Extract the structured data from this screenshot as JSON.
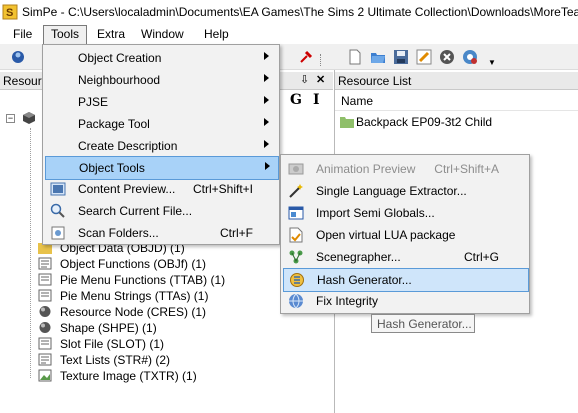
{
  "window": {
    "title": "SimPe - C:\\Users\\localadmin\\Documents\\EA Games\\The Sims 2 Ultimate Collection\\Downloads\\MoreTea_..."
  },
  "menubar": {
    "items": [
      "File",
      "Tools",
      "Extra",
      "Window",
      "Help"
    ]
  },
  "left_panel": {
    "header": "Resource",
    "header_buttons": [
      "⇩",
      "✕"
    ],
    "text_buttons": [
      "G",
      "I"
    ]
  },
  "right_panel": {
    "header": "Resource List",
    "column": "Name",
    "item": "Backpack EP09-3t2 Child"
  },
  "tree": {
    "items": [
      "Object Data (OBJD) (1)",
      "Object Functions (OBJf) (1)",
      "Pie Menu Functions (TTAB) (1)",
      "Pie Menu Strings (TTAs) (1)",
      "Resource Node (CRES) (1)",
      "Shape (SHPE) (1)",
      "Slot File (SLOT) (1)",
      "Text Lists (STR#) (2)",
      "Texture Image (TXTR) (1)"
    ]
  },
  "tools_menu": {
    "items": [
      {
        "label": "Object Creation",
        "submenu": true
      },
      {
        "label": "Neighbourhood",
        "submenu": true
      },
      {
        "label": "PJSE",
        "submenu": true
      },
      {
        "label": "Package Tool",
        "submenu": true
      },
      {
        "label": "Create Description",
        "submenu": true
      },
      {
        "label": "Object Tools",
        "submenu": true
      },
      {
        "label": "Content Preview...",
        "shortcut": "Ctrl+Shift+I"
      },
      {
        "label": "Search Current File..."
      },
      {
        "label": "Scan Folders...",
        "shortcut": "Ctrl+F"
      }
    ]
  },
  "object_tools_submenu": {
    "items": [
      {
        "label": "Animation Preview",
        "shortcut": "Ctrl+Shift+A",
        "disabled": true
      },
      {
        "label": "Single Language Extractor..."
      },
      {
        "label": "Import Semi Globals..."
      },
      {
        "label": "Open virtual LUA package"
      },
      {
        "label": "Scenegrapher...",
        "shortcut": "Ctrl+G"
      },
      {
        "label": "Hash Generator..."
      },
      {
        "label": "Fix Integrity"
      }
    ]
  },
  "tooltip": {
    "text": "Hash Generator..."
  },
  "colors": {
    "highlight": "#a8d2f8",
    "highlight_border": "#5a9ad8",
    "menu_bg": "#f2f2f2"
  }
}
